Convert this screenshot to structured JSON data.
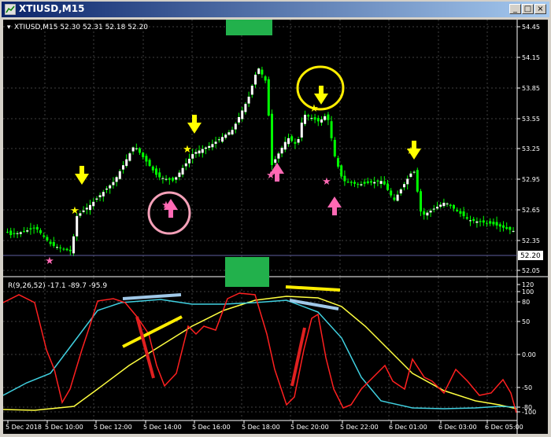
{
  "window": {
    "title": "XTIUSD,M15"
  },
  "price_panel": {
    "header": "XTIUSD,M15  52.30 52.31 52.18 52.20",
    "current_price": "52.20",
    "price_labels": [
      "54.45",
      "54.15",
      "53.85",
      "53.55",
      "53.25",
      "52.95",
      "52.65",
      "52.35",
      "52.05"
    ]
  },
  "indicator_panel": {
    "header": "R(9,26,52) -17.1 -89.7 -95.9",
    "labels": [
      "120",
      "100",
      "80",
      "50",
      "0.00",
      "-50",
      "-80",
      "-100"
    ]
  },
  "time_labels": [
    "5 Dec 2018",
    "5 Dec 10:00",
    "5 Dec 12:00",
    "5 Dec 14:00",
    "5 Dec 16:00",
    "5 Dec 18:00",
    "5 Dec 20:00",
    "5 Dec 22:00",
    "6 Dec 01:00",
    "6 Dec 03:00",
    "6 Dec 05:00"
  ],
  "colors": {
    "bull": "#ffffff",
    "bear": "#00ff00",
    "grid": "#404040",
    "r_fast": "#ff2020",
    "r_mid": "#40d0e0",
    "r_slow": "#ffff40",
    "highlight": "#22b14c"
  },
  "icons": [
    "window-icon",
    "minimize-icon",
    "maximize-icon",
    "close-icon",
    "up-arrow-icon",
    "down-arrow-icon",
    "star-icon"
  ]
}
